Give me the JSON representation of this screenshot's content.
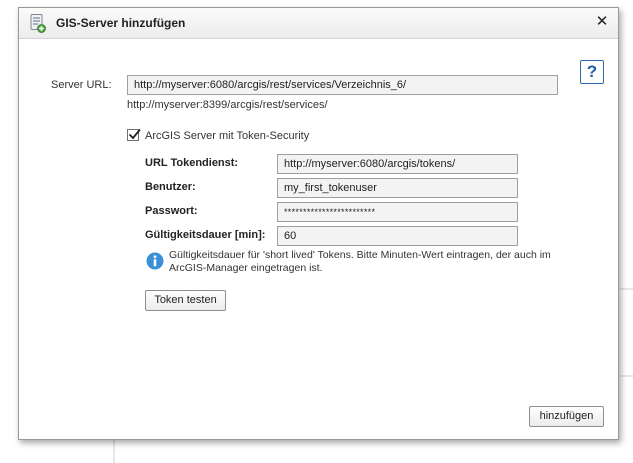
{
  "dialog": {
    "title": "GIS-Server hinzufügen",
    "close_label": "✕",
    "help_label": "?"
  },
  "server": {
    "label": "Server URL:",
    "value": "http://myserver:6080/arcgis/rest/services/Verzeichnis_6/",
    "hint": "http://myserver:8399/arcgis/rest/services/"
  },
  "token_security": {
    "checked": true,
    "label": "ArcGIS Server mit Token-Security"
  },
  "token": {
    "url_label": "URL Tokendienst:",
    "url_value": "http://myserver:6080/arcgis/tokens/",
    "user_label": "Benutzer:",
    "user_value": "my_first_tokenuser",
    "password_label": "Passwort:",
    "password_value": "************************",
    "duration_label": "Gültigkeitsdauer [min]:",
    "duration_value": "60",
    "info_text": "Gültigkeitsdauer für 'short lived' Tokens. Bitte Minuten-Wert eintragen, der auch im ArcGIS-Manager eingetragen ist.",
    "test_button": "Token testen"
  },
  "footer": {
    "add_button": "hinzufügen"
  },
  "colors": {
    "accent": "#1d5ea8",
    "info": "#3a8fd6",
    "field_bg": "#f3f3f3"
  },
  "icons": {
    "title": "server-add-icon",
    "info": "info-icon",
    "close": "close-icon",
    "help": "help-icon"
  }
}
